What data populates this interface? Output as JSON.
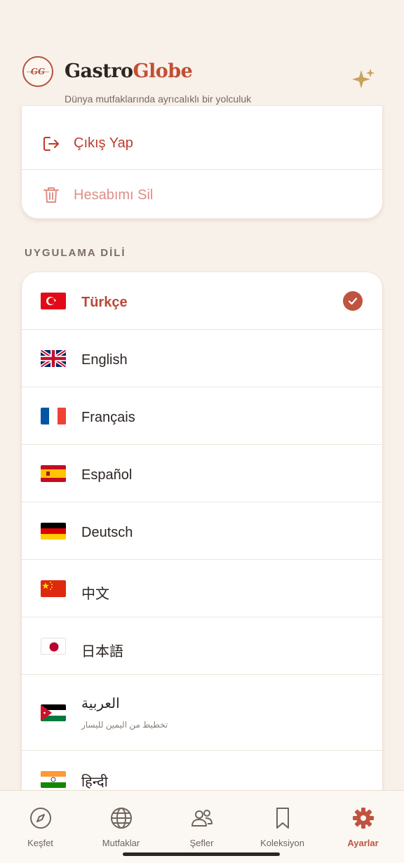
{
  "header": {
    "logo_text": "GG",
    "brand_part1": "Gastro",
    "brand_part2": "Globe",
    "tagline": "Dünya mutfaklarında ayrıcalıklı bir yolculuk",
    "accent_color": "#c24e35"
  },
  "account": {
    "logout_label": "Çıkış Yap",
    "delete_label": "Hesabımı Sil"
  },
  "language_section": {
    "title": "UYGULAMA DİLİ",
    "selected": "Türkçe",
    "languages": [
      {
        "label": "Türkçe",
        "flag": "flag-turkey"
      },
      {
        "label": "English",
        "flag": "flag-uk"
      },
      {
        "label": "Français",
        "flag": "flag-france"
      },
      {
        "label": "Español",
        "flag": "flag-spain"
      },
      {
        "label": "Deutsch",
        "flag": "flag-germany"
      },
      {
        "label": "中文",
        "flag": "flag-china"
      },
      {
        "label": "日本語",
        "flag": "flag-japan"
      },
      {
        "label": "العربية",
        "flag": "flag-jordan",
        "sublabel": "تخطيط من اليمين لليسار"
      },
      {
        "label": "हिन्दी",
        "flag": "flag-india"
      }
    ]
  },
  "tabs": [
    {
      "label": "Keşfet",
      "icon": "compass-icon"
    },
    {
      "label": "Mutfaklar",
      "icon": "globe-icon"
    },
    {
      "label": "Şefler",
      "icon": "people-icon"
    },
    {
      "label": "Koleksiyon",
      "icon": "bookmark-icon"
    },
    {
      "label": "Ayarlar",
      "icon": "gear-icon",
      "active": true
    }
  ]
}
